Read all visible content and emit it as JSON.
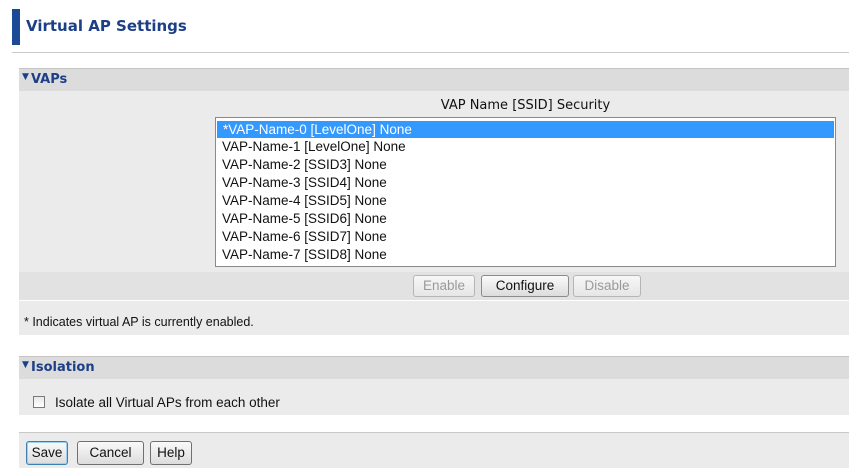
{
  "page": {
    "title": "Virtual AP Settings"
  },
  "vaps": {
    "section_label": "VAPs",
    "column_header": "VAP Name [SSID] Security",
    "items": [
      "*VAP-Name-0 [LevelOne] None",
      "VAP-Name-1 [LevelOne] None",
      "VAP-Name-2 [SSID3] None",
      "VAP-Name-3 [SSID4] None",
      "VAP-Name-4 [SSID5] None",
      "VAP-Name-5 [SSID6] None",
      "VAP-Name-6 [SSID7] None",
      "VAP-Name-7 [SSID8] None"
    ],
    "selected_index": 0,
    "buttons": {
      "enable": "Enable",
      "configure": "Configure",
      "disable": "Disable"
    },
    "note": "* Indicates virtual AP is currently enabled."
  },
  "isolation": {
    "section_label": "Isolation",
    "checkbox_label": "Isolate all Virtual APs from each other",
    "checked": false
  },
  "footer": {
    "save": "Save",
    "cancel": "Cancel",
    "help": "Help"
  },
  "colors": {
    "accent": "#1c4a96",
    "heading": "#1c3f86",
    "selection": "#3399ff"
  }
}
